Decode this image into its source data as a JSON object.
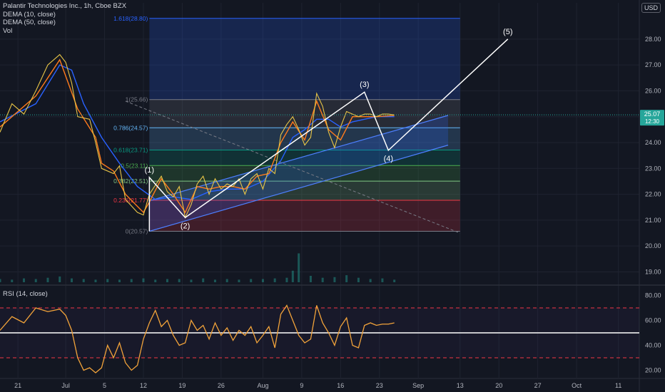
{
  "legend": {
    "symbol": "Palantir Technologies Inc., 1h, Cboe BZX",
    "dema10": "DEMA (10, close)",
    "dema50": "DEMA (50, close)",
    "vol": "Vol"
  },
  "rsi_legend": "RSI (14, close)",
  "currency": "USD",
  "colors": {
    "background": "#131722",
    "grid": "#1f2330",
    "price": "#e8c547",
    "dema10": "#ff7b1c",
    "dema50": "#2962ff",
    "rsi": "#f2a33a",
    "current_price_tag": "#26a69a"
  },
  "chart_data": [
    {
      "type": "line",
      "panel": "price",
      "y_axis": {
        "ylim": [
          18.6,
          29.4
        ],
        "ticks": [
          "28.00",
          "27.00",
          "26.00",
          "25.00",
          "24.00",
          "23.00",
          "22.00",
          "21.00",
          "20.00",
          "19.00"
        ],
        "tick_values": [
          28,
          27,
          26,
          25,
          24,
          23,
          22,
          21,
          20,
          19
        ]
      },
      "x_axis": {
        "ticks": [
          "21",
          "Jul",
          "5",
          "12",
          "19",
          "26",
          "Aug",
          "9",
          "16",
          "23",
          "Sep",
          "13",
          "20",
          "27",
          "Oct",
          "11"
        ],
        "tick_values": [
          -8,
          0,
          6.5,
          13,
          19.5,
          26,
          33,
          39.5,
          46,
          52.5,
          59,
          66,
          72.5,
          79,
          85.5,
          92.5
        ],
        "xlim": [
          -11,
          96
        ]
      },
      "current_price": {
        "label": "25.07",
        "countdown": "12:30",
        "value": 25.07
      },
      "price_path": {
        "x": [
          -11,
          -9,
          -7,
          -5,
          -3,
          -1,
          0,
          1,
          2,
          4,
          5,
          6,
          8,
          9,
          10,
          12,
          13,
          14,
          16,
          17,
          18,
          19,
          20,
          21,
          22,
          23,
          24,
          25,
          26,
          27,
          28,
          29,
          30,
          31,
          32,
          33,
          34,
          35,
          36,
          37,
          38,
          39,
          40,
          41,
          42,
          43,
          44,
          45,
          46,
          47,
          48,
          49,
          50,
          51,
          52,
          53,
          54,
          55
        ],
        "y": [
          24.4,
          25.5,
          25.1,
          26.0,
          27.0,
          27.4,
          27.1,
          26.3,
          25.0,
          24.9,
          24.0,
          23.0,
          22.8,
          23.1,
          21.8,
          21.3,
          21.2,
          22.0,
          22.7,
          22.1,
          21.9,
          22.3,
          21.1,
          21.6,
          22.4,
          22.7,
          22.0,
          22.6,
          22.2,
          22.4,
          22.3,
          22.6,
          22.0,
          22.6,
          22.8,
          22.2,
          23.0,
          22.8,
          24.3,
          24.7,
          25.0,
          24.5,
          23.9,
          24.2,
          25.9,
          25.4,
          24.4,
          23.8,
          24.6,
          25.2,
          25.1,
          25.0,
          25.1,
          25.1,
          25.0,
          25.1,
          25.1,
          25.07
        ]
      },
      "dema10_path": {
        "x": [
          -11,
          -5,
          -1,
          2,
          5,
          6,
          8,
          10,
          13,
          14,
          16,
          18,
          20,
          22,
          24,
          26,
          28,
          30,
          32,
          34,
          36,
          38,
          40,
          42,
          44,
          46,
          48,
          50,
          52,
          55
        ],
        "y": [
          24.6,
          25.8,
          27.2,
          25.3,
          24.2,
          23.2,
          22.9,
          22.0,
          21.3,
          21.7,
          22.6,
          22.0,
          21.3,
          22.3,
          22.2,
          22.3,
          22.3,
          22.2,
          22.7,
          22.8,
          24.0,
          24.8,
          24.1,
          25.6,
          24.5,
          24.1,
          25.0,
          25.0,
          25.0,
          25.05
        ]
      },
      "dema50_path": {
        "x": [
          -11,
          -5,
          -1,
          1,
          3,
          6,
          9,
          12,
          15,
          18,
          21,
          24,
          27,
          30,
          33,
          36,
          38,
          40,
          42,
          44,
          46,
          48,
          50,
          52,
          55
        ],
        "y": [
          24.8,
          25.5,
          27.0,
          26.8,
          25.5,
          24.2,
          23.2,
          22.3,
          21.8,
          21.9,
          21.8,
          22.1,
          22.2,
          22.2,
          22.5,
          23.3,
          24.2,
          24.5,
          24.9,
          24.9,
          24.6,
          24.8,
          24.9,
          25.0,
          25.0
        ]
      },
      "fibonacci": [
        {
          "label": "0(20.57)",
          "ratio": 0,
          "price": 20.57,
          "color": "#787b86"
        },
        {
          "label": "0.236(21.77)",
          "ratio": 0.236,
          "price": 21.77,
          "color": "#f23645"
        },
        {
          "label": "0.382(22.51)",
          "ratio": 0.382,
          "price": 22.51,
          "color": "#81c784"
        },
        {
          "label": "0.5(23.11)",
          "ratio": 0.5,
          "price": 23.11,
          "color": "#4caf50"
        },
        {
          "label": "0.618(23.71)",
          "ratio": 0.618,
          "price": 23.71,
          "color": "#089981"
        },
        {
          "label": "0.786(24.57)",
          "ratio": 0.786,
          "price": 24.57,
          "color": "#64b5f6"
        },
        {
          "label": "1(25.66)",
          "ratio": 1,
          "price": 25.66,
          "color": "#787b86"
        },
        {
          "label": "1.618(28.80)",
          "ratio": 1.618,
          "price": 28.8,
          "color": "#2962ff"
        }
      ],
      "fib_x_range": [
        14,
        66
      ],
      "elliott_waves": {
        "labels": [
          "(1)",
          "(2)",
          "(3)",
          "(4)",
          "(5)"
        ],
        "x": [
          14,
          20,
          50,
          54,
          74
        ],
        "y": [
          22.65,
          21.1,
          25.95,
          23.7,
          28.0
        ],
        "start": {
          "x": 14,
          "y": 20.57
        }
      },
      "channel": {
        "lower": {
          "x1": 14,
          "y1": 20.57,
          "x2": 64,
          "y2": 23.9
        },
        "upper": {
          "x1": 14,
          "y1": 21.75,
          "x2": 64,
          "y2": 25.05
        }
      },
      "dashed_trendline": {
        "x1": 10,
        "y1": 25.6,
        "x2": 66,
        "y2": 20.5
      },
      "volume": {
        "x": [
          -11,
          -9,
          -7,
          -5,
          -3,
          -1,
          1,
          3,
          5,
          7,
          9,
          11,
          13,
          15,
          17,
          19,
          21,
          23,
          25,
          27,
          29,
          31,
          33,
          35,
          37,
          38,
          39,
          41,
          43,
          45,
          47,
          49,
          51,
          53,
          55
        ],
        "v": [
          0.5,
          0.4,
          0.6,
          0.5,
          0.7,
          0.9,
          0.6,
          0.5,
          0.4,
          0.5,
          0.4,
          0.5,
          0.6,
          0.4,
          0.5,
          0.5,
          0.4,
          0.6,
          0.4,
          0.5,
          0.4,
          0.5,
          0.5,
          0.6,
          0.7,
          1.8,
          4.5,
          1.0,
          0.7,
          0.8,
          1.1,
          0.7,
          0.5,
          0.6,
          0.4
        ]
      }
    },
    {
      "type": "line",
      "panel": "rsi",
      "y_axis": {
        "ylim": [
          14,
          86
        ],
        "ticks": [
          "80.00",
          "60.00",
          "40.00",
          "20.00"
        ],
        "tick_values": [
          80,
          60,
          40,
          20
        ]
      },
      "bands": {
        "upper": 70,
        "middle": 50,
        "lower": 30
      },
      "series": [
        {
          "x": [
            -11,
            -9,
            -7,
            -5,
            -3,
            -1,
            0,
            1,
            2,
            3,
            4,
            5,
            6,
            7,
            8,
            9,
            10,
            11,
            12,
            13,
            14,
            15,
            16,
            17,
            18,
            19,
            20,
            21,
            22,
            23,
            24,
            25,
            26,
            27,
            28,
            29,
            30,
            31,
            32,
            33,
            34,
            35,
            36,
            37,
            38,
            39,
            40,
            41,
            42,
            43,
            44,
            45,
            46,
            47,
            48,
            49,
            50,
            51,
            52,
            53,
            54,
            55
          ],
          "y": [
            52,
            63,
            58,
            70,
            67,
            69,
            64,
            52,
            30,
            20,
            22,
            18,
            22,
            40,
            30,
            42,
            26,
            20,
            24,
            45,
            58,
            68,
            55,
            60,
            48,
            40,
            42,
            60,
            52,
            56,
            45,
            58,
            48,
            54,
            44,
            52,
            48,
            55,
            42,
            48,
            55,
            38,
            65,
            72,
            60,
            48,
            42,
            45,
            72,
            58,
            50,
            40,
            55,
            62,
            40,
            38,
            56,
            58,
            56,
            57,
            57,
            58
          ]
        }
      ]
    }
  ]
}
